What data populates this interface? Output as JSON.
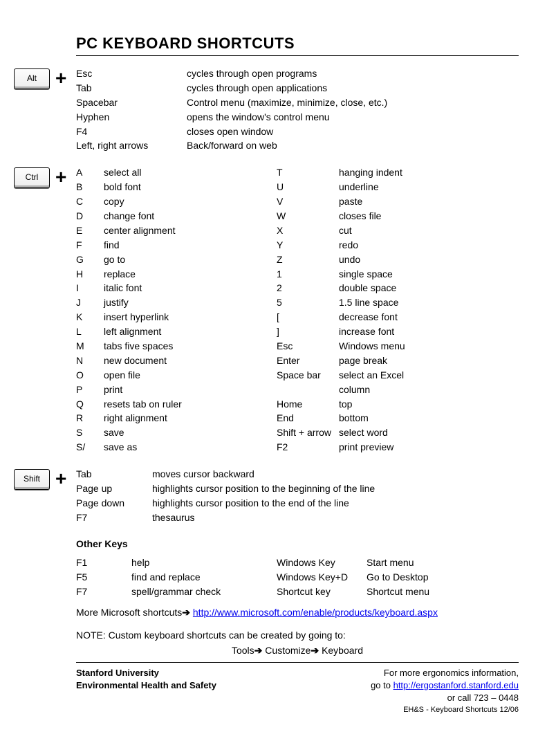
{
  "title": "PC KEYBOARD SHORTCUTS",
  "alt": {
    "label": "Alt",
    "rows": [
      {
        "k": "Esc",
        "d": "cycles through open programs"
      },
      {
        "k": "Tab",
        "d": "cycles through open applications"
      },
      {
        "k": "Spacebar",
        "d": "Control menu (maximize, minimize, close, etc.)"
      },
      {
        "k": "Hyphen",
        "d": "opens the window's control menu"
      },
      {
        "k": "F4",
        "d": "closes open window"
      },
      {
        "k": "Left, right arrows",
        "d": "Back/forward on web"
      }
    ]
  },
  "ctrl": {
    "label": "Ctrl",
    "left": [
      {
        "k": "A",
        "d": "select all"
      },
      {
        "k": "B",
        "d": "bold font"
      },
      {
        "k": "C",
        "d": "copy"
      },
      {
        "k": "D",
        "d": "change font"
      },
      {
        "k": "E",
        "d": "center alignment"
      },
      {
        "k": "F",
        "d": "find"
      },
      {
        "k": "G",
        "d": "go to"
      },
      {
        "k": "H",
        "d": "replace"
      },
      {
        "k": "I",
        "d": "italic font"
      },
      {
        "k": "J",
        "d": "justify"
      },
      {
        "k": "K",
        "d": "insert hyperlink"
      },
      {
        "k": "L",
        "d": "left alignment"
      },
      {
        "k": "M",
        "d": "tabs five spaces"
      },
      {
        "k": "N",
        "d": "new document"
      },
      {
        "k": "O",
        "d": "open file"
      },
      {
        "k": "P",
        "d": "print"
      },
      {
        "k": "Q",
        "d": "resets tab on ruler"
      },
      {
        "k": "R",
        "d": "right alignment"
      },
      {
        "k": "S",
        "d": "save"
      },
      {
        "k": "S/",
        "d": "save as"
      }
    ],
    "right": [
      {
        "k": "T",
        "d": "hanging indent"
      },
      {
        "k": "U",
        "d": "underline"
      },
      {
        "k": "V",
        "d": "paste"
      },
      {
        "k": "W",
        "d": "closes file"
      },
      {
        "k": "X",
        "d": "cut"
      },
      {
        "k": "Y",
        "d": "redo"
      },
      {
        "k": "Z",
        "d": "undo"
      },
      {
        "k": "1",
        "d": "single space"
      },
      {
        "k": "2",
        "d": "double space"
      },
      {
        "k": "5",
        "d": "1.5 line space"
      },
      {
        "k": "[",
        "d": "decrease font"
      },
      {
        "k": "]",
        "d": "increase font"
      },
      {
        "k": "Esc",
        "d": "Windows menu"
      },
      {
        "k": "Enter",
        "d": "page break"
      },
      {
        "k": "Space bar",
        "d": "select an Excel column"
      },
      {
        "k": "Home",
        "d": "top"
      },
      {
        "k": "End",
        "d": "bottom"
      },
      {
        "k": "Shift + arrow",
        "d": "select word"
      },
      {
        "k": "F2",
        "d": "print preview"
      }
    ]
  },
  "shift": {
    "label": "Shift",
    "rows": [
      {
        "k": "Tab",
        "d": "moves cursor backward"
      },
      {
        "k": "Page up",
        "d": "highlights cursor position to the beginning of the line"
      },
      {
        "k": "Page down",
        "d": "highlights cursor position to the end of the line"
      },
      {
        "k": "F7",
        "d": "thesaurus"
      }
    ]
  },
  "other": {
    "heading": "Other Keys",
    "rows": [
      {
        "k": "F1",
        "d": "help",
        "k2": "Windows Key",
        "d2": "Start menu"
      },
      {
        "k": "F5",
        "d": "find and replace",
        "k2": "Windows Key+D",
        "d2": "Go to Desktop"
      },
      {
        "k": "F7",
        "d": "spell/grammar check",
        "k2": "Shortcut key",
        "d2": "Shortcut menu"
      }
    ]
  },
  "more": {
    "text": "More Microsoft shortcuts",
    "url": "http://www.microsoft.com/enable/products/keyboard.aspx"
  },
  "note": {
    "line1": "NOTE: Custom keyboard shortcuts can be created by going to:",
    "tools": "Tools",
    "customize": "Customize",
    "keyboard": "Keyboard"
  },
  "footer": {
    "org1": "Stanford University",
    "org2": "Environmental Health and Safety",
    "info": "For more ergonomics information,",
    "goto": "go to ",
    "url": "http://ergostanford.stanford.edu",
    "call": "or call 723 – 0448",
    "tiny": "EH&S - Keyboard Shortcuts 12/06"
  }
}
